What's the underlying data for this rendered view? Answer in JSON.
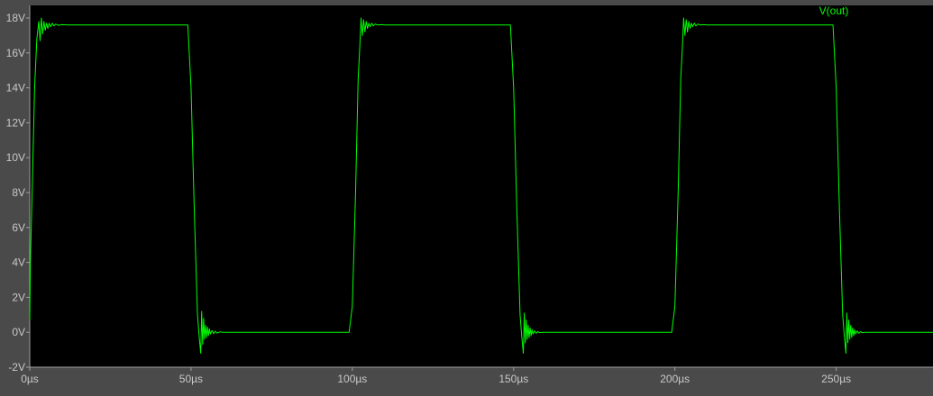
{
  "colors": {
    "background": "#4a4a4a",
    "plot_background": "#000000",
    "trace": "#00ff00",
    "axis_text": "#c8c8c8",
    "frame": "#a0a0a0"
  },
  "chart_data": {
    "type": "line",
    "title": "",
    "xlabel": "",
    "ylabel": "",
    "xlim": [
      0,
      280
    ],
    "ylim": [
      -2,
      18
    ],
    "grid": false,
    "legend": "top-right",
    "x_unit": "µs",
    "y_unit": "V",
    "x_ticks": [
      0,
      50,
      100,
      150,
      200,
      250
    ],
    "x_tick_labels": [
      "0µs",
      "50µs",
      "100µs",
      "150µs",
      "200µs",
      "250µs"
    ],
    "y_ticks": [
      -2,
      0,
      2,
      4,
      6,
      8,
      10,
      12,
      14,
      16,
      18
    ],
    "y_tick_labels": [
      "-2V",
      "0V",
      "2V",
      "4V",
      "6V",
      "8V",
      "10V",
      "12V",
      "14V",
      "16V",
      "18V"
    ],
    "series": [
      {
        "name": "V(out)",
        "color": "#00ff00",
        "x": [
          0,
          0.2,
          0.8,
          1.5,
          2.2,
          2.8,
          3.2,
          3.6,
          4.0,
          4.4,
          4.8,
          5.2,
          5.6,
          6.0,
          6.5,
          7.0,
          7.5,
          8.0,
          9.0,
          10.0,
          12.0,
          14.0,
          20.0,
          30.0,
          40.0,
          49.0,
          50.0,
          51.0,
          52.0,
          52.5,
          53.0,
          53.3,
          53.6,
          53.9,
          54.2,
          54.5,
          54.8,
          55.1,
          55.4,
          55.7,
          56.0,
          56.5,
          57.0,
          57.5,
          58.0,
          59.0,
          60.0,
          62.0,
          65.0,
          70.0,
          80.0,
          90.0,
          99.0,
          100.0,
          101.0,
          101.8,
          102.3,
          102.7,
          103.1,
          103.5,
          103.9,
          104.3,
          104.7,
          105.1,
          105.5,
          106.0,
          106.5,
          107.0,
          108.0,
          109.0,
          110.0,
          112.0,
          115.0,
          120.0,
          130.0,
          140.0,
          149.0,
          150.0,
          151.0,
          152.0,
          152.5,
          153.0,
          153.3,
          153.6,
          153.9,
          154.2,
          154.5,
          154.8,
          155.1,
          155.4,
          155.7,
          156.0,
          156.5,
          157.0,
          157.5,
          158.0,
          159.0,
          160.0,
          162.0,
          165.0,
          170.0,
          180.0,
          190.0,
          199.0,
          200.0,
          201.0,
          201.8,
          202.3,
          202.7,
          203.1,
          203.5,
          203.9,
          204.3,
          204.7,
          205.1,
          205.5,
          206.0,
          206.5,
          207.0,
          208.0,
          209.0,
          210.0,
          212.0,
          215.0,
          220.0,
          230.0,
          240.0,
          249.0,
          250.0,
          251.0,
          252.0,
          252.5,
          253.0,
          253.3,
          253.6,
          253.9,
          254.2,
          254.5,
          254.8,
          255.1,
          255.4,
          255.7,
          256.0,
          256.5,
          257.0,
          257.5,
          258.0,
          259.0,
          260.0,
          262.0,
          265.0,
          270.0,
          280.0
        ],
        "y": [
          0.7,
          4,
          8.4,
          14,
          16.8,
          17.8,
          16.7,
          18.0,
          17.1,
          17.8,
          17.3,
          17.7,
          17.4,
          17.7,
          17.5,
          17.7,
          17.55,
          17.65,
          17.58,
          17.62,
          17.6,
          17.6,
          17.6,
          17.6,
          17.6,
          17.6,
          14.0,
          7.0,
          1.0,
          -0.2,
          -1.2,
          1.2,
          -0.7,
          0.8,
          -0.4,
          0.4,
          -0.3,
          0.3,
          -0.2,
          0.2,
          -0.1,
          0.1,
          -0.08,
          0.06,
          -0.04,
          0.02,
          0,
          0,
          0,
          0,
          0,
          0,
          0,
          1.5,
          8.0,
          14.5,
          16.3,
          18.0,
          17.0,
          17.9,
          17.2,
          17.8,
          17.4,
          17.7,
          17.5,
          17.7,
          17.55,
          17.65,
          17.6,
          17.62,
          17.6,
          17.6,
          17.6,
          17.6,
          17.6,
          17.6,
          17.6,
          14.0,
          7.0,
          1.0,
          -0.2,
          -1.2,
          1.1,
          -0.6,
          0.7,
          -0.4,
          0.4,
          -0.3,
          0.25,
          -0.2,
          0.15,
          -0.1,
          0.08,
          -0.06,
          0.04,
          -0.02,
          0,
          0,
          0,
          0,
          0,
          0,
          0,
          0,
          1.5,
          8.0,
          14.5,
          16.3,
          18.0,
          17.0,
          17.9,
          17.2,
          17.8,
          17.4,
          17.7,
          17.5,
          17.7,
          17.55,
          17.65,
          17.6,
          17.62,
          17.6,
          17.6,
          17.6,
          17.6,
          17.6,
          17.6,
          17.6,
          14.0,
          7.0,
          1.0,
          -0.2,
          -1.2,
          1.1,
          -0.6,
          0.7,
          -0.4,
          0.4,
          -0.3,
          0.25,
          -0.2,
          0.15,
          -0.1,
          0.08,
          -0.06,
          0.04,
          -0.02,
          0,
          0,
          0,
          0,
          0,
          0
        ]
      }
    ]
  }
}
